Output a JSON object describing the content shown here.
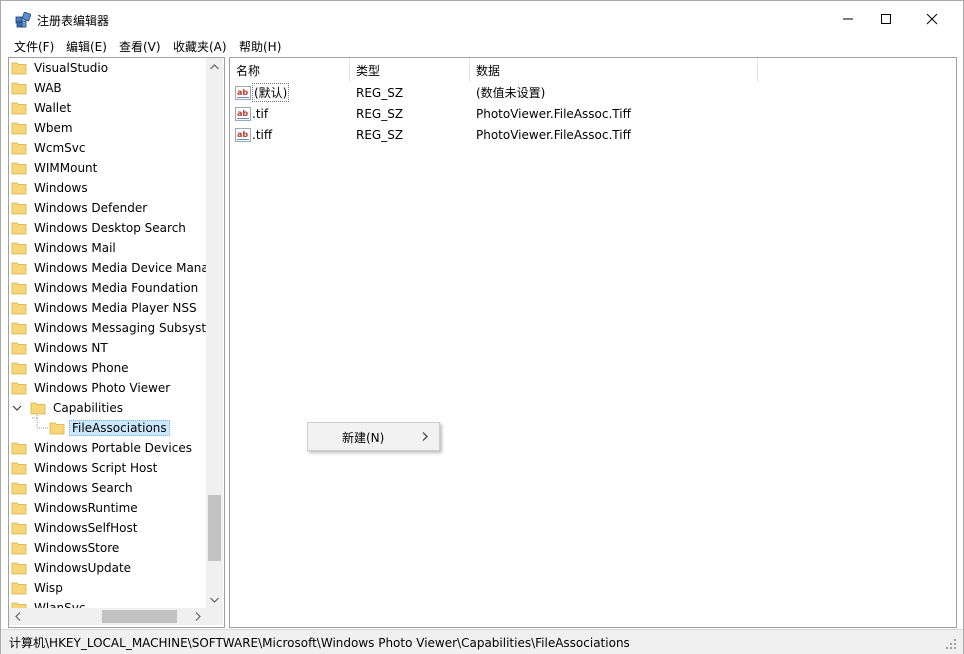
{
  "window": {
    "title": "注册表编辑器"
  },
  "menu": {
    "items": [
      {
        "label": "文件(F)"
      },
      {
        "label": "编辑(E)"
      },
      {
        "label": "查看(V)"
      },
      {
        "label": "收藏夹(A)"
      },
      {
        "label": "帮助(H)"
      }
    ]
  },
  "tree": {
    "items": [
      {
        "label": "VisualStudio"
      },
      {
        "label": "WAB"
      },
      {
        "label": "Wallet"
      },
      {
        "label": "Wbem"
      },
      {
        "label": "WcmSvc"
      },
      {
        "label": "WIMMount"
      },
      {
        "label": "Windows"
      },
      {
        "label": "Windows Defender"
      },
      {
        "label": "Windows Desktop Search"
      },
      {
        "label": "Windows Mail"
      },
      {
        "label": "Windows Media Device Manager"
      },
      {
        "label": "Windows Media Foundation"
      },
      {
        "label": "Windows Media Player NSS"
      },
      {
        "label": "Windows Messaging Subsystem"
      },
      {
        "label": "Windows NT"
      },
      {
        "label": "Windows Phone"
      },
      {
        "label": "Windows Photo Viewer"
      },
      {
        "label": "Capabilities"
      },
      {
        "label": "FileAssociations"
      },
      {
        "label": "Windows Portable Devices"
      },
      {
        "label": "Windows Script Host"
      },
      {
        "label": "Windows Search"
      },
      {
        "label": "WindowsRuntime"
      },
      {
        "label": "WindowsSelfHost"
      },
      {
        "label": "WindowsStore"
      },
      {
        "label": "WindowsUpdate"
      },
      {
        "label": "Wisp"
      },
      {
        "label": "WlanSvc"
      }
    ],
    "selected": "FileAssociations"
  },
  "list": {
    "columns": [
      {
        "label": "名称"
      },
      {
        "label": "类型"
      },
      {
        "label": "数据"
      }
    ],
    "rows": [
      {
        "name": "(默认)",
        "type": "REG_SZ",
        "data": "(数值未设置)"
      },
      {
        "name": ".tif",
        "type": "REG_SZ",
        "data": "PhotoViewer.FileAssoc.Tiff"
      },
      {
        "name": ".tiff",
        "type": "REG_SZ",
        "data": "PhotoViewer.FileAssoc.Tiff"
      }
    ]
  },
  "context_menu": {
    "items": [
      {
        "label": "新建(N)",
        "has_submenu": true
      }
    ]
  },
  "status": {
    "path": "计算机\\HKEY_LOCAL_MACHINE\\SOFTWARE\\Microsoft\\Windows Photo Viewer\\Capabilities\\FileAssociations"
  },
  "colors": {
    "folder": "#f7d679",
    "selection": "#cce8ff",
    "ab_icon_red": "#c0392b"
  }
}
